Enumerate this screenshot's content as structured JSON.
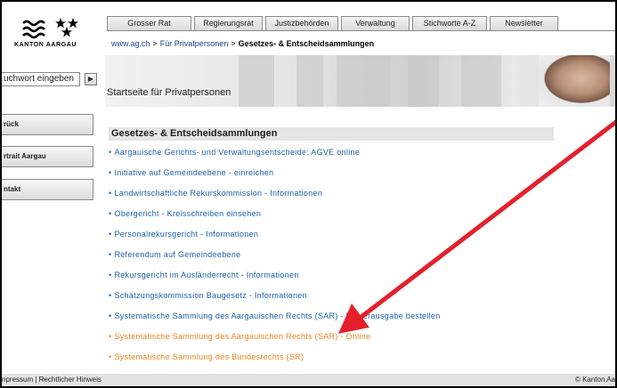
{
  "brand": {
    "logo_text": "KANTON AARGAU"
  },
  "colors": {
    "link": "#1a5fa8",
    "link_highlight": "#e8821a",
    "arrow": "#e4202b"
  },
  "top_nav": {
    "tabs": [
      {
        "label": "Grosser Rat"
      },
      {
        "label": "Regierungsrat"
      },
      {
        "label": "Justizbehörden"
      },
      {
        "label": "Verwaltung"
      },
      {
        "label": "Stichworte A-Z"
      },
      {
        "label": "Newsletter"
      }
    ]
  },
  "breadcrumb": {
    "home": "www.ag.ch",
    "parent": "Für Privatpersonen",
    "current": "Gesetzes- & Entscheidsammlungen",
    "separator": ">"
  },
  "banner": {
    "title": "Startseite für Privatpersonen"
  },
  "sidebar": {
    "search_value": "uchwort eingeben",
    "search_go_icon": "triangle-right-icon",
    "buttons": [
      {
        "label": "rück"
      },
      {
        "label": "rtrait Aargau"
      },
      {
        "label": "ntakt"
      }
    ]
  },
  "content": {
    "heading": "Gesetzes- & Entscheidsammlungen",
    "bullet": "•",
    "links": [
      {
        "label": "Aargauische Gerichts- und Verwaltungsentscheide: AGVE online",
        "highlight": false
      },
      {
        "label": "Initiative auf Gemeindeebene - einreichen",
        "highlight": false
      },
      {
        "label": "Landwirtschaftliche Rekurskommission - Informationen",
        "highlight": false
      },
      {
        "label": "Obergericht - Kreisschreiben einsehen",
        "highlight": false
      },
      {
        "label": "Personalrekursgericht - Informationen",
        "highlight": false
      },
      {
        "label": "Referendum auf Gemeindeebene",
        "highlight": false
      },
      {
        "label": "Rekursgericht im Ausländerrecht - Informationen",
        "highlight": false
      },
      {
        "label": "Schätzungskommission Baugesetz - Informationen",
        "highlight": false
      },
      {
        "label": "Systematische Sammlung des Aargauischen Rechts (SAR) - Papierausgabe bestellen",
        "highlight": false
      },
      {
        "label": "Systematische Sammlung des Aargauischen Rechts (SAR) - Online",
        "highlight": true
      },
      {
        "label": "Systematische Sammlung des Bundesrechts (SR)",
        "highlight": true
      }
    ]
  },
  "footer": {
    "left": "npressum | Rechtlicher Hinweis",
    "right": "© Kanton Aa"
  }
}
